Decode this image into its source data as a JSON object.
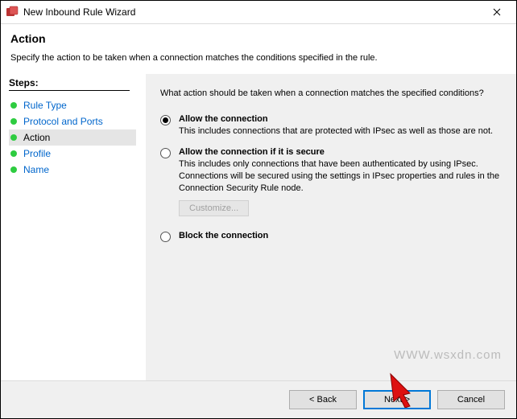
{
  "window": {
    "title": "New Inbound Rule Wizard"
  },
  "header": {
    "title": "Action",
    "subtitle": "Specify the action to be taken when a connection matches the conditions specified in the rule."
  },
  "sidebar": {
    "label": "Steps:",
    "items": [
      {
        "label": "Rule Type",
        "active": false
      },
      {
        "label": "Protocol and Ports",
        "active": false
      },
      {
        "label": "Action",
        "active": true
      },
      {
        "label": "Profile",
        "active": false
      },
      {
        "label": "Name",
        "active": false
      }
    ]
  },
  "content": {
    "question": "What action should be taken when a connection matches the specified conditions?",
    "options": {
      "allow": {
        "title": "Allow the connection",
        "desc": "This includes connections that are protected with IPsec as well as those are not.",
        "checked": true
      },
      "secure": {
        "title": "Allow the connection if it is secure",
        "desc": "This includes only connections that have been authenticated by using IPsec.  Connections will be secured using the settings in IPsec properties and rules in the Connection Security Rule node.",
        "customize": "Customize...",
        "checked": false
      },
      "block": {
        "title": "Block the connection",
        "checked": false
      }
    }
  },
  "footer": {
    "back": "< Back",
    "next": "Next >",
    "cancel": "Cancel"
  },
  "watermark": "WWW.wsxdn.com"
}
